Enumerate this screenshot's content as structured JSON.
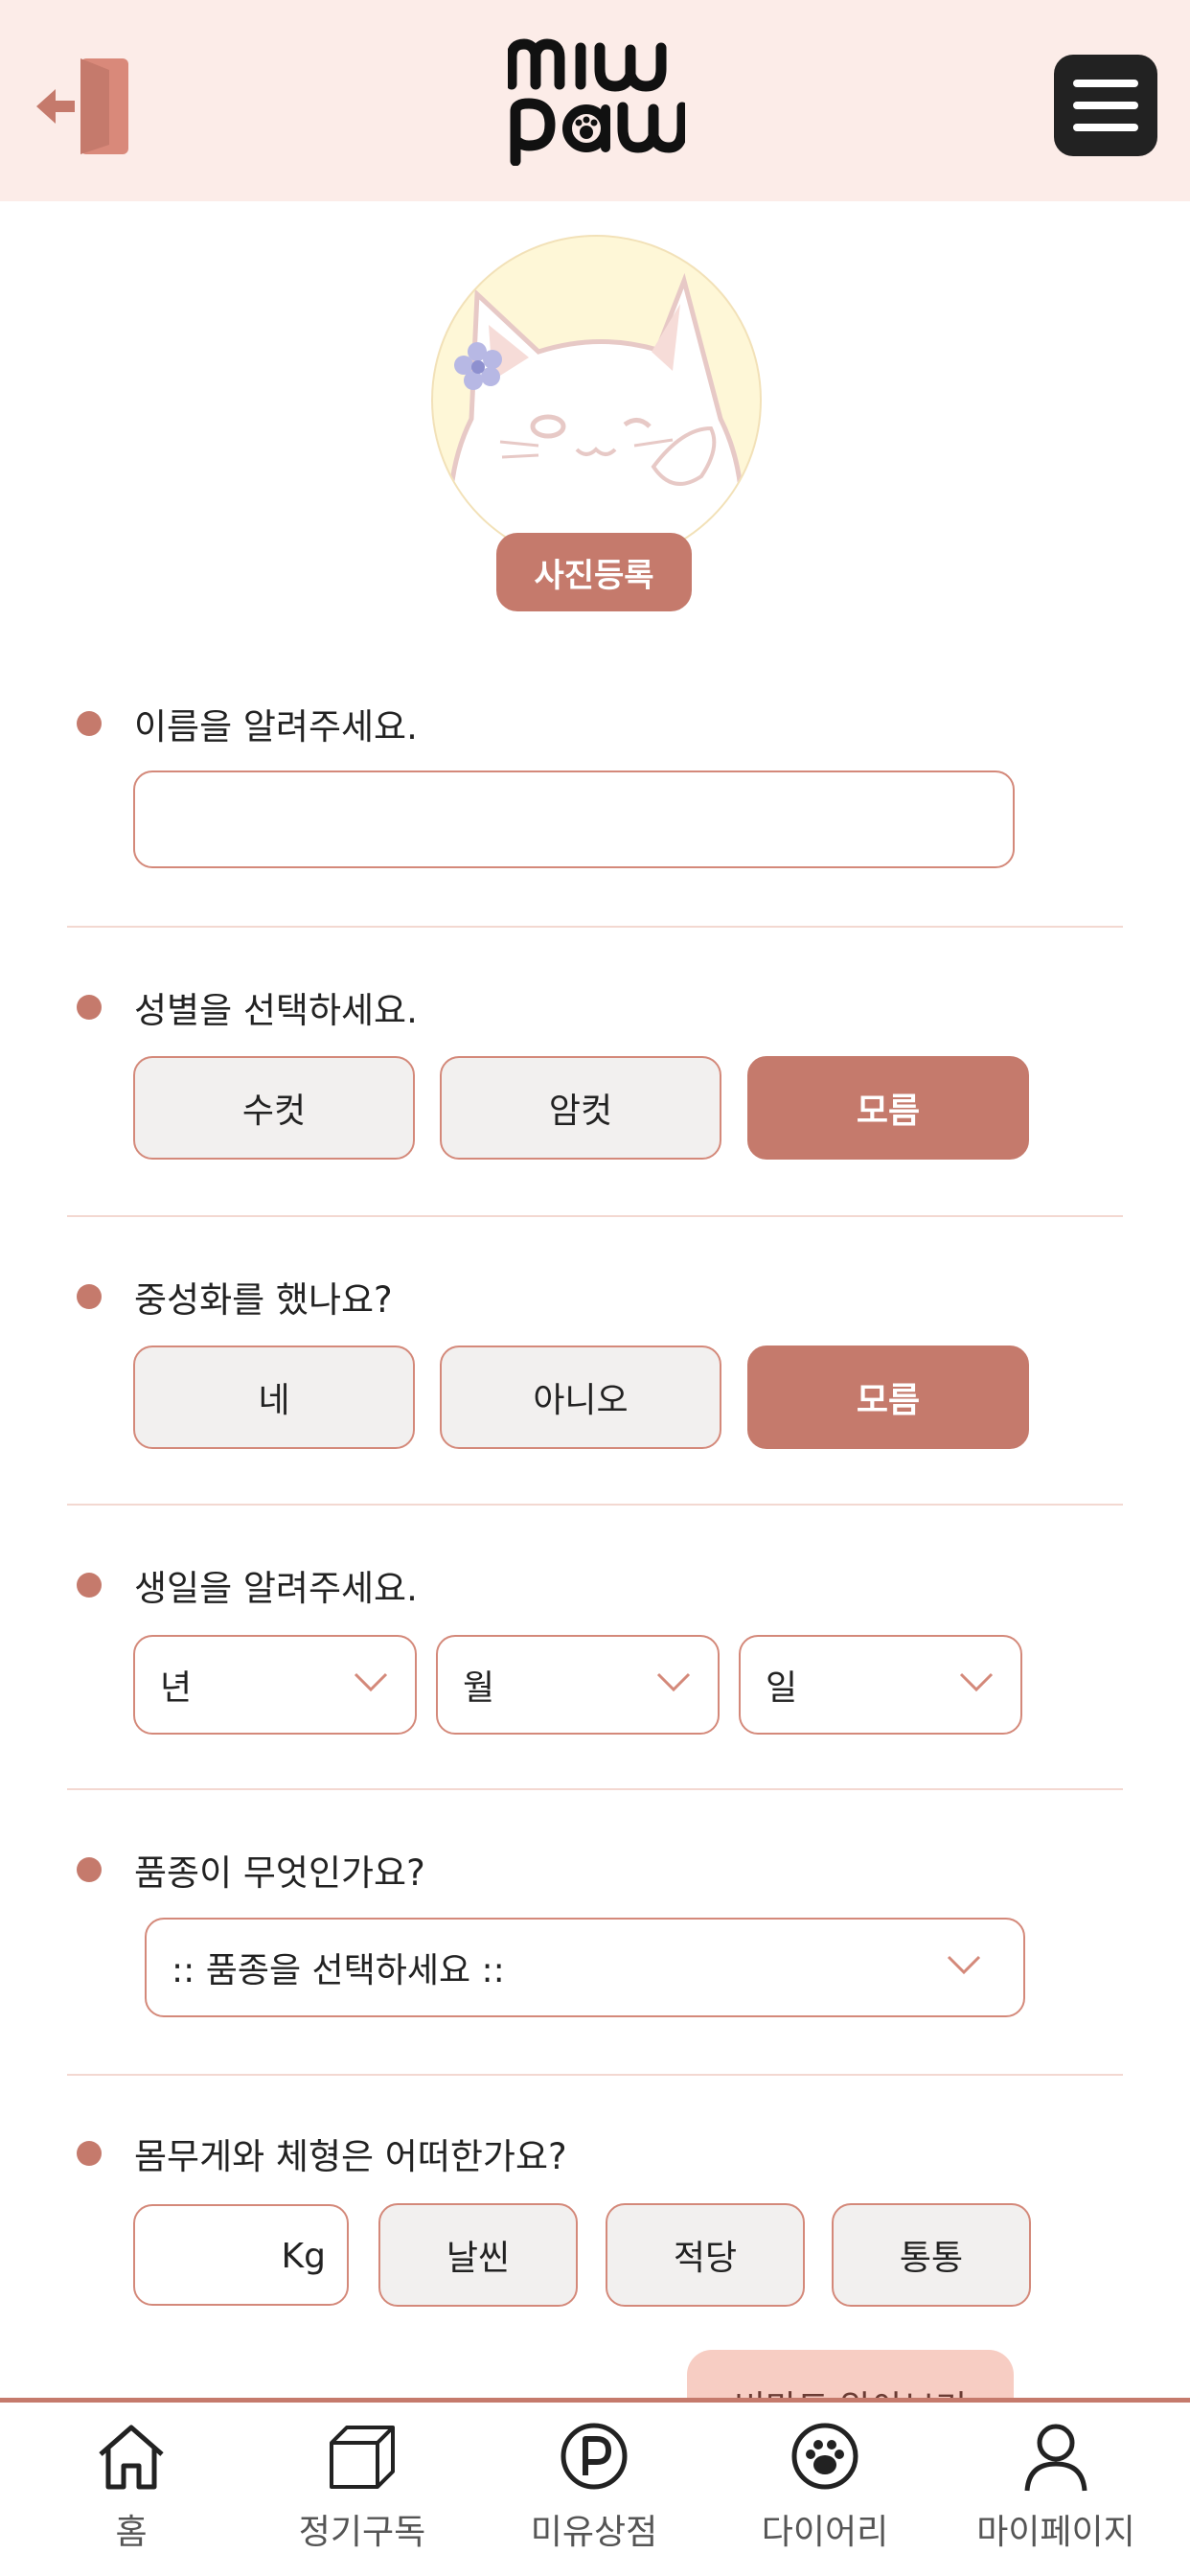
{
  "header": {
    "logo_line1": "miw",
    "logo_line2": "paw",
    "logout_icon": "logout-door-icon",
    "menu_icon": "hamburger-menu-icon"
  },
  "profile": {
    "photo_button": "사진등록"
  },
  "name_section": {
    "question": "이름을 알려주세요.",
    "value": ""
  },
  "gender_section": {
    "question": "성별을 선택하세요.",
    "options": [
      "수컷",
      "암컷",
      "모름"
    ],
    "selected": "모름"
  },
  "neuter_section": {
    "question": "중성화를 했나요?",
    "options": [
      "네",
      "아니오",
      "모름"
    ],
    "selected": "모름"
  },
  "birthday_section": {
    "question": "생일을 알려주세요.",
    "year": "년",
    "month": "월",
    "day": "일"
  },
  "breed_section": {
    "question": "품종이 무엇인가요?",
    "selected": ":: 품종을 선택하세요 ::"
  },
  "body_section": {
    "question": "몸무게와 체형은 어떠한가요?",
    "weight_unit": "Kg",
    "options": [
      "날씬",
      "적당",
      "통통"
    ]
  },
  "bmi_button": "비만도 알아보기",
  "tabbar": {
    "items": [
      {
        "label": "홈",
        "icon": "home-icon"
      },
      {
        "label": "정기구독",
        "icon": "box-icon"
      },
      {
        "label": "미유상점",
        "icon": "point-icon"
      },
      {
        "label": "다이어리",
        "icon": "paw-icon"
      },
      {
        "label": "마이페이지",
        "icon": "user-icon"
      }
    ]
  },
  "colors": {
    "accent": "#c57a6c",
    "header_bg": "#fcece8",
    "border": "#d4897a",
    "option_bg": "#f2f0ef"
  }
}
